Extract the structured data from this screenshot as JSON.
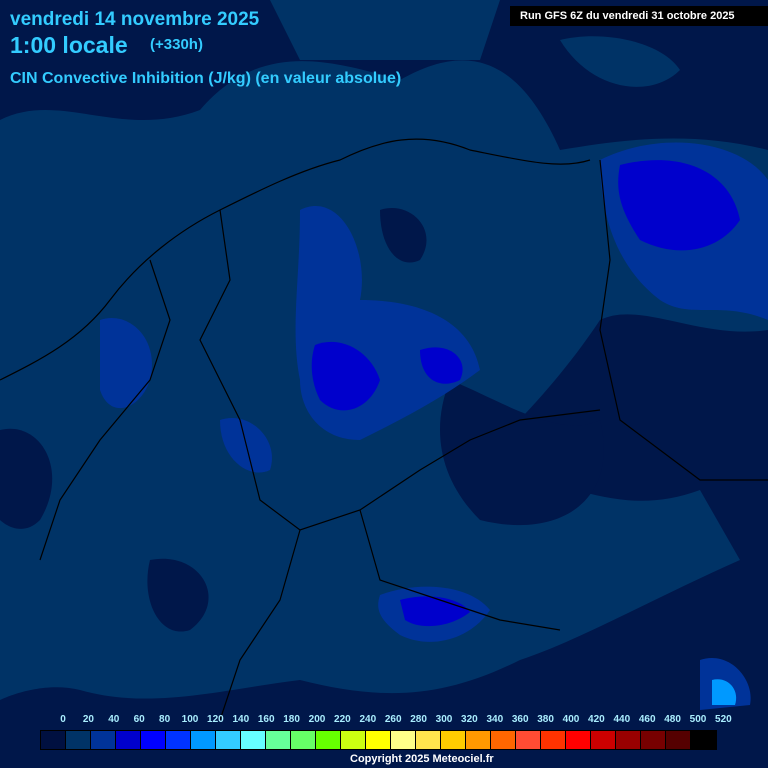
{
  "header": {
    "date": "vendredi 14 novembre 2025",
    "hour": "1:00 locale",
    "offset": "(+330h)",
    "parameter": "CIN Convective Inhibition (J/kg) (en valeur absolue)",
    "run": "Run GFS 6Z du vendredi 31 octobre 2025"
  },
  "legend": {
    "labels": [
      "0",
      "20",
      "40",
      "60",
      "80",
      "100",
      "120",
      "140",
      "160",
      "180",
      "200",
      "220",
      "240",
      "260",
      "280",
      "300",
      "320",
      "340",
      "360",
      "380",
      "400",
      "420",
      "440",
      "460",
      "480",
      "500",
      "520"
    ],
    "colors": [
      "#001040",
      "#003366",
      "#003399",
      "#0000cc",
      "#0000ff",
      "#0033ff",
      "#0099ff",
      "#33ccff",
      "#66ffff",
      "#66ff99",
      "#66ff66",
      "#66ff00",
      "#ccff11",
      "#ffff00",
      "#ffff88",
      "#ffe44d",
      "#ffcc00",
      "#ff9900",
      "#ff6600",
      "#ff4c33",
      "#ff3300",
      "#ff0000",
      "#cc0000",
      "#990000",
      "#770000",
      "#550000",
      "#000000"
    ]
  },
  "copyright": "Copyright 2025 Meteociel.fr"
}
